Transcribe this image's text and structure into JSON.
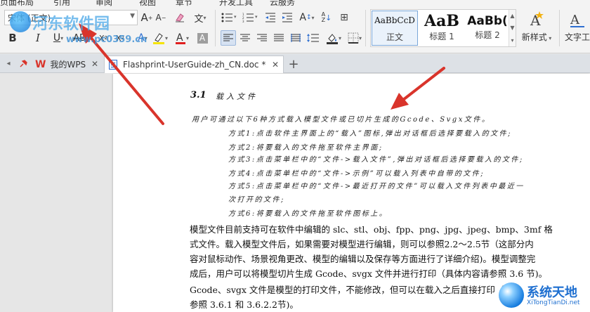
{
  "menu": {
    "items": [
      "页面布局",
      "引用",
      "审阅",
      "视图",
      "章节",
      "开发工具",
      "云服务"
    ]
  },
  "ribbon": {
    "font_name": "宋体 (正文)",
    "style_gallery": {
      "cards": [
        {
          "sample": "AaBbCcD",
          "label": "正文",
          "selected": true
        },
        {
          "sample": "AaB",
          "label": "标题 1",
          "selected": false
        },
        {
          "sample": "AaBb(",
          "label": "标题 2",
          "selected": false
        }
      ]
    },
    "new_style_label": "新样式",
    "text_tools_label": "文字工"
  },
  "tabs": [
    {
      "label": "我的WPS",
      "icon": "wps-logo-icon",
      "active": false
    },
    {
      "label": "Flashprint-UserGuide-zh_CN.doc *",
      "icon": "document-icon",
      "active": true
    }
  ],
  "document": {
    "heading_number": "3.1",
    "heading_title": "载入文件",
    "handwritten_lines": [
      "用户可通过以下6种方式载入模型文件或已切片生成的Gcode、Svgx文件。",
      "方式1:点击软件主界面上的“载入”图标,弹出对话框后选择要载入的文件;",
      "方式2:将要载入的文件拖至软件主界面;",
      "方式3:点击菜单栏中的“文件->载入文件”,弹出对话框后选择要载入的文件;",
      "方式4:点击菜单栏中的“文件->示例”可以载入列表中自带的文件;",
      "方式5:点击菜单栏中的“文件->最近打开的文件”可以载入文件列表中最近一",
      "次打开的文件;",
      "方式6:将要载入的文件拖至软件图标上。"
    ],
    "paragraph1": [
      "模型文件目前支持可在软件中编辑的 slc、stl、obj、fpp、png、jpg、jpeg、bmp、3mf 格",
      "式文件。载入模型文件后，如果需要对模型进行编辑，则可以参照2.2～2.5节（这部分内",
      "容对鼠标动作、场景视角更改、模型的编辑以及保存等方面进行了详细介绍)。模型调整完",
      "成后，用户可以将模型切片生成 Gcode、svgx 文件并进行打印（具体内容请参照 3.6 节)。"
    ],
    "paragraph2": [
      "Gcode、svgx 文件是模型的打印文件，不能修改，但可以在载入之后直接打印（",
      "参照 3.6.1 和 3.6.2.2节)。"
    ]
  },
  "watermarks": {
    "left_title": "河东软件园",
    "left_url": "www.pc0359.cn",
    "right_title": "系统天地",
    "right_url": "XiTongTianDi.net"
  },
  "colors": {
    "accent": "#2f6fd1",
    "arrow": "#d9342b",
    "page": "#ffffff",
    "workspace": "#e6e6e6"
  }
}
